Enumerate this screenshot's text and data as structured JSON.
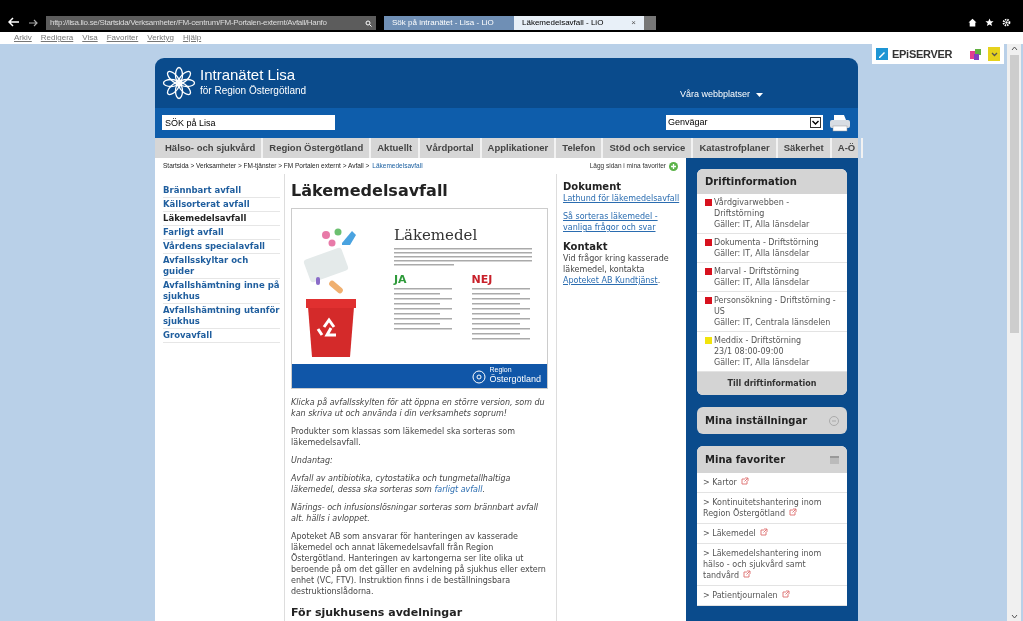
{
  "browser": {
    "address": "http://lisa.lio.se/Startsida/Verksamheter/FM-centrum/FM-Portalen-externt/Avfall/Hanfo",
    "tabs": [
      {
        "label": "Sök på intranätet - Lisa - LiO",
        "selected": false
      },
      {
        "label": "Läkemedelsavfall - LiO",
        "selected": true
      }
    ],
    "close": "×",
    "menu": [
      "Arkiv",
      "Redigera",
      "Visa",
      "Favoriter",
      "Verktyg",
      "Hjälp"
    ]
  },
  "episerver": {
    "label": "EPiSERVER"
  },
  "site": {
    "title": "Intranätet Lisa",
    "subtitle": "för Region Östergötland",
    "websites": "Våra webbplatser"
  },
  "search": {
    "value": "SÖK på Lisa"
  },
  "shortcuts": {
    "value": "Genvägar"
  },
  "nav": [
    "Hälso- och sjukvård",
    "Region Östergötland",
    "Aktuellt",
    "Vårdportal",
    "Applikationer",
    "Telefon",
    "Stöd och service",
    "Katastrofplaner",
    "Säkerhet",
    "A-Ö"
  ],
  "breadcrumb": {
    "trail": "Startsida > Verksamheter > FM-tjänster > FM Portalen externt > Avfall >",
    "current": "Läkemedelsavfall"
  },
  "add_favorite": "Lägg sidan i mina favoriter",
  "left_menu": [
    {
      "label": "Brännbart avfall",
      "selected": false
    },
    {
      "label": "Källsorterat avfall",
      "selected": false
    },
    {
      "label": "Läkemedelsavfall",
      "selected": true
    },
    {
      "label": "Farligt avfall",
      "selected": false
    },
    {
      "label": "Vårdens specialavfall",
      "selected": false
    },
    {
      "label": "Avfallsskyltar och guider",
      "selected": false
    },
    {
      "label": "Avfallshämtning inne på sjukhus",
      "selected": false
    },
    {
      "label": "Avfallshämtning utanför sjukhus",
      "selected": false
    },
    {
      "label": "Grovavfall",
      "selected": false
    }
  ],
  "article": {
    "title": "Läkemedelsavfall",
    "poster": {
      "heading": "Läkemedel",
      "yes": "JA",
      "no": "NEJ",
      "brand_top": "Region",
      "brand": "Östergötland"
    },
    "paragraphs": [
      {
        "text": "Klicka på avfallsskylten för att öppna en större version, som du kan skriva ut och använda i din verksamhets soprum!",
        "italic": true
      },
      {
        "text": "Produkter som klassas som läkemedel ska sorteras som läkemedelsavfall.",
        "italic": false
      },
      {
        "text": "Undantag:",
        "italic": true
      },
      {
        "text": "Avfall av antibiotika, cytostatika och tungmetallhaltiga läkemedel, dessa ska sorteras som",
        "link": "farligt avfall",
        "after": ".",
        "italic": true
      },
      {
        "text": "Närings- och infusionslösningar sorteras som brännbart avfall alt. hälls i avloppet.",
        "italic": true
      },
      {
        "text": "Apoteket AB som ansvarar för hanteringen av kasserade läkemedel och annat läkemedelsavfall från Region Östergötland. Hanteringen av kartongerna ser lite olika ut beroende på om det gäller en avdelning på sjukhus eller extern enhet (VC, FTV). Instruktion finns i de beställningsbara destruktionslådorna.",
        "italic": false
      }
    ],
    "subheading": "För sjukhusens avdelningar"
  },
  "documents": {
    "heading": "Dokument",
    "links": [
      "Lathund för läkemedelsavfall",
      "Så sorteras läkemedel - vanliga frågor och svar"
    ]
  },
  "contact": {
    "heading": "Kontakt",
    "text": "Vid frågor kring kasserade läkemedel, kontakta",
    "link": "Apoteket AB Kundtjänst",
    "after": "."
  },
  "drift": {
    "title": "Driftinformation",
    "items": [
      {
        "color": "#d7111e",
        "title": "Vårdgivarwebben - Driftstörning",
        "scope": "Gäller: IT, Alla länsdelar"
      },
      {
        "color": "#d7111e",
        "title": "Dokumenta - Driftstörning",
        "scope": "Gäller: IT, Alla länsdelar"
      },
      {
        "color": "#d7111e",
        "title": "Marval - Driftstörning",
        "scope": "Gäller: IT, Alla länsdelar"
      },
      {
        "color": "#d7111e",
        "title": "Personsökning - Driftstörning - US",
        "scope": "Gäller: IT, Centrala länsdelen"
      },
      {
        "color": "#f2e40c",
        "title": "Meddix - Driftstörning",
        "time": "23/1 08:00-09:00",
        "scope": "Gäller: IT, Alla länsdelar"
      }
    ],
    "button": "Till driftinformation"
  },
  "settings": {
    "title": "Mina inställningar"
  },
  "favorites": {
    "title": "Mina favoriter",
    "items": [
      "> Kartor",
      "> Kontinuitetshantering inom Region Östergötland",
      "> Läkemedel",
      "> Läkemedelshantering inom hälso - och sjukvård samt tandvård",
      "> Patientjournalen"
    ]
  }
}
